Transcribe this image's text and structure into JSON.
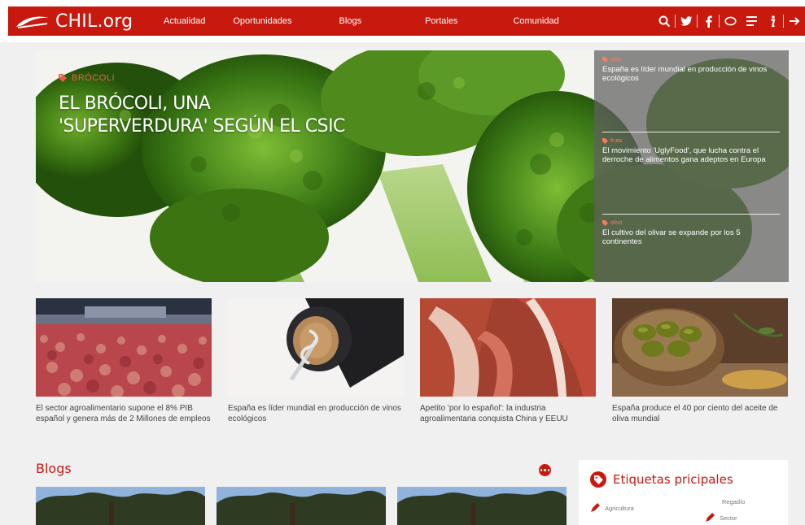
{
  "site": {
    "logo_text": "CHIL.org"
  },
  "nav": {
    "links": [
      "Actualidad",
      "Oportunidades",
      "Blogs",
      "Portales",
      "Comunidad"
    ]
  },
  "hero": {
    "tag": "BRÓCOLI",
    "title_line1": "EL BRÓCOLI, UNA",
    "title_line2": "'SUPERVERDURA' SEGÚN EL CSIC"
  },
  "side_news": [
    {
      "tag": "vino",
      "text": "España es líder mundial en producción de vinos ecológicos"
    },
    {
      "tag": "fruta",
      "text": "El movimiento 'UglyFood', que lucha contra el derroche de alimentos gana adeptos en Europa"
    },
    {
      "tag": "olivo",
      "text": "El cultivo del olivar se expande por los 5 continentes"
    }
  ],
  "cards": [
    {
      "caption": "El sector agroalimentario supone el 8% PIB español y genera más de 2 Millones de empleos",
      "image": "apples-warehouse"
    },
    {
      "caption": "España es líder mundial en producción de vinos ecológicos",
      "image": "wine-corkscrew"
    },
    {
      "caption": "Apetito 'por lo español': la industria agroalimentaria conquista China y EEUU",
      "image": "cured-ham"
    },
    {
      "caption": "España produce el 40 por ciento del aceite de oliva mundial",
      "image": "olives-bowl"
    }
  ],
  "blogs": {
    "title": "Blogs"
  },
  "tags_box": {
    "title": "Etiquetas pricipales",
    "items": [
      "Agricultura",
      "Regadío",
      "Sector"
    ]
  },
  "colors": {
    "brand_red": "#c8190f",
    "tag_orange": "#e46048",
    "background": "#f0f0f0"
  }
}
